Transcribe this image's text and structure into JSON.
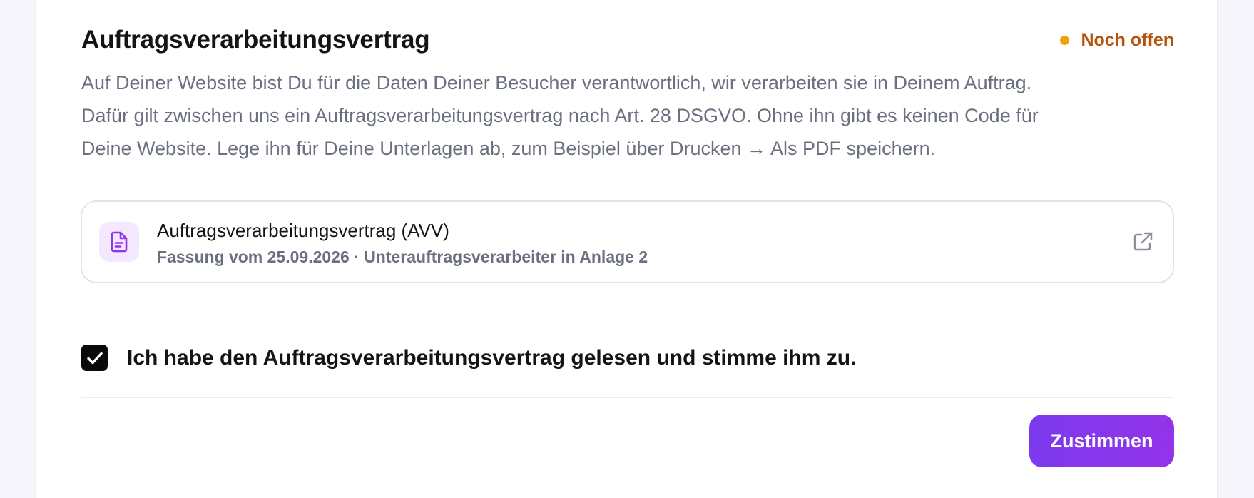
{
  "section": {
    "title": "Auftragsverarbeitungsvertrag",
    "status_label": "Noch offen",
    "description_lines": [
      "Auf Deiner Website bist Du für die Daten Deiner Besucher verantwortlich, wir verarbeiten sie in Deinem Auftrag.",
      "Dafür gilt zwischen uns ein Auftragsverarbeitungsvertrag nach Art. 28 DSGVO. Ohne ihn gibt es keinen Code für",
      "Deine Website. Lege ihn für Deine Unterlagen ab, zum Beispiel über Drucken → Als PDF speichern."
    ]
  },
  "document": {
    "icon": "document-icon",
    "title": "Auftragsverarbeitungsvertrag (AVV)",
    "subtitle": "Fassung vom 25.09.2026 · Unterauftragsverarbeiter in Anlage 2",
    "link_icon": "external-link-icon"
  },
  "consent": {
    "checked": true,
    "label": "Ich habe den Auftragsverarbeitungsvertrag gelesen und stimme ihm zu."
  },
  "actions": {
    "submit_label": "Zustimmen"
  },
  "colors": {
    "status_text": "#b45309",
    "status_dot": "#f59e0b",
    "button_gradient_start": "#7c3aed",
    "button_gradient_end": "#9333ea",
    "doc_icon_bg": "#f3e8ff",
    "doc_icon_fg": "#9333ea"
  }
}
